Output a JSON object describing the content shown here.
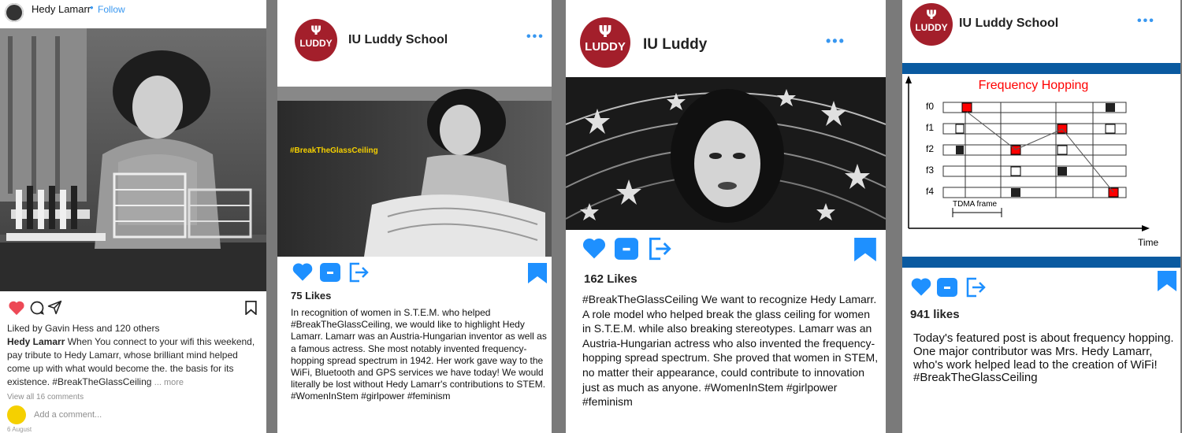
{
  "colors": {
    "accent_blue": "#1e90ff",
    "iu_red": "#a31f2b",
    "follow_blue": "#3897f0",
    "freq_band": "#0a5aa0",
    "hop_red": "#ff0000"
  },
  "card1": {
    "username": "Hedy Lamarr",
    "follow_separator": "•",
    "follow_label": "Follow",
    "liked_by": "Liked by Gavin Hess and 120 others",
    "caption_user": "Hedy Lamarr",
    "caption_text": " When You connect to your wifi this weekend, pay tribute to Hedy Lamarr, whose brilliant mind helped come up with what would become the. the basis for its existence. #BreakTheGlassCeiling",
    "more_label": "... more",
    "view_comments": "View all 16 comments",
    "add_comment_placeholder": "Add a comment...",
    "date": "6 August"
  },
  "card2": {
    "logo_text": "LUDDY",
    "handle": "IU Luddy School",
    "hashtag_overlay": "#BreakTheGlassCeiling",
    "likes": "75 Likes",
    "caption": "In recognition of women in S.T.E.M. who helped #BreakTheGlassCeiling, we would like to highlight Hedy Lamarr. Lamarr was an Austria-Hungarian inventor as well as a famous actress. She most notably invented frequency-hopping spread spectrum in 1942. Her work gave way to the WiFi, Bluetooth and GPS services we have today! We would literally be lost without Hedy Lamarr's contributions to STEM. #WomenInStem #girlpower #feminism"
  },
  "card3": {
    "logo_text": "LUDDY",
    "handle": "IU Luddy",
    "likes": "162 Likes",
    "caption": " #BreakTheGlassCeiling We want to recognize Hedy Lamarr. A role model who helped break the glass ceiling for women in S.T.E.M. while also breaking stereotypes. Lamarr was an Austria-Hungarian actress who also invented the frequency- hopping spread spectrum. She proved that women in STEM, no matter their appearance, could contribute to innovation just as much as anyone. #WomenInStem #girlpower #feminism"
  },
  "card4": {
    "logo_text": "LUDDY",
    "handle": "IU Luddy School",
    "likes": "941 likes",
    "caption": "Today's featured post is about frequency hopping. One major contributor was Mrs. Hedy Lamarr, who's work helped lead to the creation of WiFi! #BreakTheGlassCeiling",
    "diagram": {
      "title": "Frequency Hopping",
      "row_labels": [
        "f0",
        "f1",
        "f2",
        "f3",
        "f4"
      ],
      "frame_label": "TDMA frame",
      "time_label": "Time"
    }
  }
}
